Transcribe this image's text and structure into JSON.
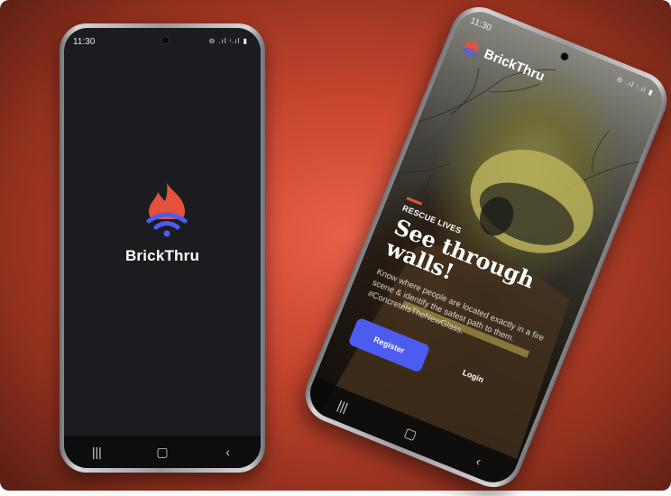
{
  "background": {
    "color": "#d9553c"
  },
  "phone_left": {
    "status": {
      "time": "11:30",
      "icons": "⊖ .ıl ᵎ.ıl ▮"
    },
    "brand": "BrickThru",
    "nav": {
      "recents": "|||",
      "home": "▢",
      "back": "‹"
    }
  },
  "phone_right": {
    "status": {
      "time": "11:30",
      "icons": "⊖ .ıl ᵎ.ıl ▮"
    },
    "brand": "BrickThru",
    "eyebrow": "RESCUE LIVES",
    "headline": "See through walls!",
    "body": "Know where people are located exactly in a fire scene & identify the safest path to them. #ConcreteIsTheNewGlass.",
    "register_label": "Register",
    "login_label": "Login",
    "nav": {
      "recents": "|||",
      "home": "▢",
      "back": "‹"
    }
  },
  "colors": {
    "flame": "#e4523c",
    "waves": "#4c5cf0",
    "button": "#4c5cf0",
    "screen_dark": "#1b1c1f"
  }
}
